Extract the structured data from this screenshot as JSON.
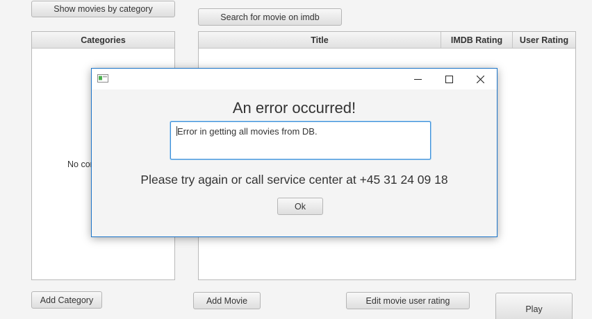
{
  "main": {
    "show_by_category_label": "Show movies by category",
    "search_imdb_label": "Search for movie on imdb",
    "categories_header": "Categories",
    "categories_placeholder": "No content in table",
    "movies_headers": {
      "title": "Title",
      "imdb_rating": "IMDB Rating",
      "user_rating": "User Rating"
    },
    "add_category_label": "Add Category",
    "add_movie_label": "Add Movie",
    "edit_rating_label": "Edit movie user rating",
    "play_label": "Play"
  },
  "dialog": {
    "heading": "An error occurred!",
    "error_text": "Error in getting all movies from DB.",
    "message": "Please try again or call service center at +45 31 24 09 18",
    "ok_label": "Ok",
    "icons": [
      "app-icon",
      "minimize-icon",
      "maximize-icon",
      "close-icon"
    ]
  }
}
